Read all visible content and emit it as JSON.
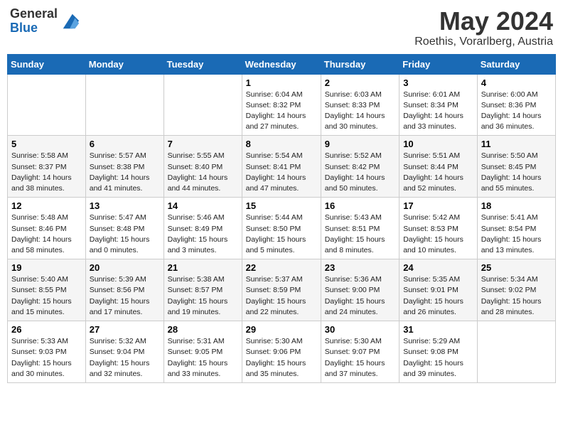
{
  "logo": {
    "general": "General",
    "blue": "Blue"
  },
  "title": "May 2024",
  "subtitle": "Roethis, Vorarlberg, Austria",
  "days_of_week": [
    "Sunday",
    "Monday",
    "Tuesday",
    "Wednesday",
    "Thursday",
    "Friday",
    "Saturday"
  ],
  "weeks": [
    [
      {
        "num": "",
        "info": ""
      },
      {
        "num": "",
        "info": ""
      },
      {
        "num": "",
        "info": ""
      },
      {
        "num": "1",
        "info": "Sunrise: 6:04 AM\nSunset: 8:32 PM\nDaylight: 14 hours\nand 27 minutes."
      },
      {
        "num": "2",
        "info": "Sunrise: 6:03 AM\nSunset: 8:33 PM\nDaylight: 14 hours\nand 30 minutes."
      },
      {
        "num": "3",
        "info": "Sunrise: 6:01 AM\nSunset: 8:34 PM\nDaylight: 14 hours\nand 33 minutes."
      },
      {
        "num": "4",
        "info": "Sunrise: 6:00 AM\nSunset: 8:36 PM\nDaylight: 14 hours\nand 36 minutes."
      }
    ],
    [
      {
        "num": "5",
        "info": "Sunrise: 5:58 AM\nSunset: 8:37 PM\nDaylight: 14 hours\nand 38 minutes."
      },
      {
        "num": "6",
        "info": "Sunrise: 5:57 AM\nSunset: 8:38 PM\nDaylight: 14 hours\nand 41 minutes."
      },
      {
        "num": "7",
        "info": "Sunrise: 5:55 AM\nSunset: 8:40 PM\nDaylight: 14 hours\nand 44 minutes."
      },
      {
        "num": "8",
        "info": "Sunrise: 5:54 AM\nSunset: 8:41 PM\nDaylight: 14 hours\nand 47 minutes."
      },
      {
        "num": "9",
        "info": "Sunrise: 5:52 AM\nSunset: 8:42 PM\nDaylight: 14 hours\nand 50 minutes."
      },
      {
        "num": "10",
        "info": "Sunrise: 5:51 AM\nSunset: 8:44 PM\nDaylight: 14 hours\nand 52 minutes."
      },
      {
        "num": "11",
        "info": "Sunrise: 5:50 AM\nSunset: 8:45 PM\nDaylight: 14 hours\nand 55 minutes."
      }
    ],
    [
      {
        "num": "12",
        "info": "Sunrise: 5:48 AM\nSunset: 8:46 PM\nDaylight: 14 hours\nand 58 minutes."
      },
      {
        "num": "13",
        "info": "Sunrise: 5:47 AM\nSunset: 8:48 PM\nDaylight: 15 hours\nand 0 minutes."
      },
      {
        "num": "14",
        "info": "Sunrise: 5:46 AM\nSunset: 8:49 PM\nDaylight: 15 hours\nand 3 minutes."
      },
      {
        "num": "15",
        "info": "Sunrise: 5:44 AM\nSunset: 8:50 PM\nDaylight: 15 hours\nand 5 minutes."
      },
      {
        "num": "16",
        "info": "Sunrise: 5:43 AM\nSunset: 8:51 PM\nDaylight: 15 hours\nand 8 minutes."
      },
      {
        "num": "17",
        "info": "Sunrise: 5:42 AM\nSunset: 8:53 PM\nDaylight: 15 hours\nand 10 minutes."
      },
      {
        "num": "18",
        "info": "Sunrise: 5:41 AM\nSunset: 8:54 PM\nDaylight: 15 hours\nand 13 minutes."
      }
    ],
    [
      {
        "num": "19",
        "info": "Sunrise: 5:40 AM\nSunset: 8:55 PM\nDaylight: 15 hours\nand 15 minutes."
      },
      {
        "num": "20",
        "info": "Sunrise: 5:39 AM\nSunset: 8:56 PM\nDaylight: 15 hours\nand 17 minutes."
      },
      {
        "num": "21",
        "info": "Sunrise: 5:38 AM\nSunset: 8:57 PM\nDaylight: 15 hours\nand 19 minutes."
      },
      {
        "num": "22",
        "info": "Sunrise: 5:37 AM\nSunset: 8:59 PM\nDaylight: 15 hours\nand 22 minutes."
      },
      {
        "num": "23",
        "info": "Sunrise: 5:36 AM\nSunset: 9:00 PM\nDaylight: 15 hours\nand 24 minutes."
      },
      {
        "num": "24",
        "info": "Sunrise: 5:35 AM\nSunset: 9:01 PM\nDaylight: 15 hours\nand 26 minutes."
      },
      {
        "num": "25",
        "info": "Sunrise: 5:34 AM\nSunset: 9:02 PM\nDaylight: 15 hours\nand 28 minutes."
      }
    ],
    [
      {
        "num": "26",
        "info": "Sunrise: 5:33 AM\nSunset: 9:03 PM\nDaylight: 15 hours\nand 30 minutes."
      },
      {
        "num": "27",
        "info": "Sunrise: 5:32 AM\nSunset: 9:04 PM\nDaylight: 15 hours\nand 32 minutes."
      },
      {
        "num": "28",
        "info": "Sunrise: 5:31 AM\nSunset: 9:05 PM\nDaylight: 15 hours\nand 33 minutes."
      },
      {
        "num": "29",
        "info": "Sunrise: 5:30 AM\nSunset: 9:06 PM\nDaylight: 15 hours\nand 35 minutes."
      },
      {
        "num": "30",
        "info": "Sunrise: 5:30 AM\nSunset: 9:07 PM\nDaylight: 15 hours\nand 37 minutes."
      },
      {
        "num": "31",
        "info": "Sunrise: 5:29 AM\nSunset: 9:08 PM\nDaylight: 15 hours\nand 39 minutes."
      },
      {
        "num": "",
        "info": ""
      }
    ]
  ]
}
